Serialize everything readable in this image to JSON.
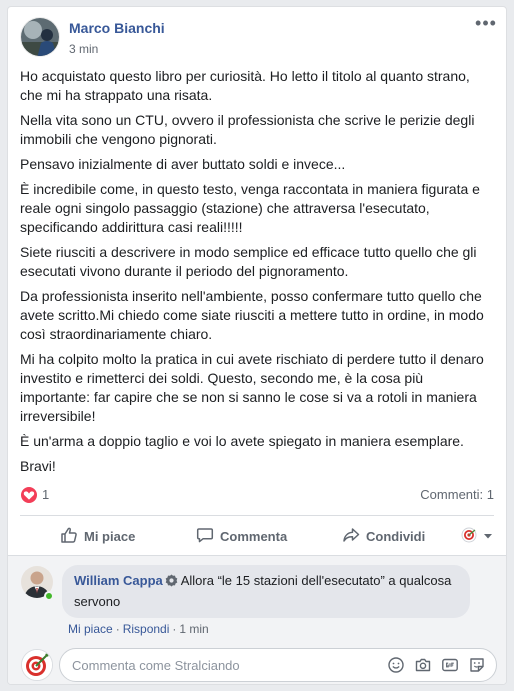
{
  "post": {
    "author": "Marco Bianchi",
    "time": "3 min",
    "more_label": "•••",
    "paragraphs": [
      "Ho acquistato questo libro per curiosità. Ho letto il titolo al quanto strano, che mi ha strappato una risata.",
      "Nella vita sono un CTU, ovvero il professionista che scrive le perizie degli immobili che vengono pignorati.",
      "Pensavo inizialmente di aver buttato soldi e invece...",
      "È incredibile come, in questo testo, venga raccontata in maniera figurata e reale ogni singolo passaggio (stazione) che attraversa l'esecutato, specificando addirittura casi reali!!!!!",
      "Siete riusciti a descrivere in modo semplice ed efficace tutto quello che gli esecutati vivono durante il periodo del pignoramento.",
      "Da professionista inserito nell'ambiente, posso confermare tutto quello che avete scritto.Mi chiedo come siate riusciti a mettere tutto in ordine, in modo così straordinariamente chiaro.",
      "Mi ha colpito molto la pratica in cui avete rischiato di perdere tutto il denaro investito e rimetterci dei soldi. Questo, secondo me, è la cosa più importante: far capire che se non si sanno le cose si va a rotoli in maniera irreversibile!",
      "È un'arma a doppio taglio e voi lo avete spiegato in maniera esemplare.",
      "Bravi!"
    ]
  },
  "stats": {
    "reactions_count": "1",
    "comments_label": "Commenti: 1"
  },
  "actions": {
    "like": "Mi piace",
    "comment": "Commenta",
    "share": "Condividi"
  },
  "comment": {
    "author": "William Cappa",
    "text": "Allora “le 15 stazioni dell'esecutato” a qualcosa servono",
    "like": "Mi piace",
    "reply": "Rispondi",
    "time": "1 min",
    "separator": "·"
  },
  "composer": {
    "placeholder": "Commenta come Stralciando"
  },
  "colors": {
    "link_blue": "#385898",
    "love_red": "#f33e58",
    "online_green": "#42b72a"
  }
}
